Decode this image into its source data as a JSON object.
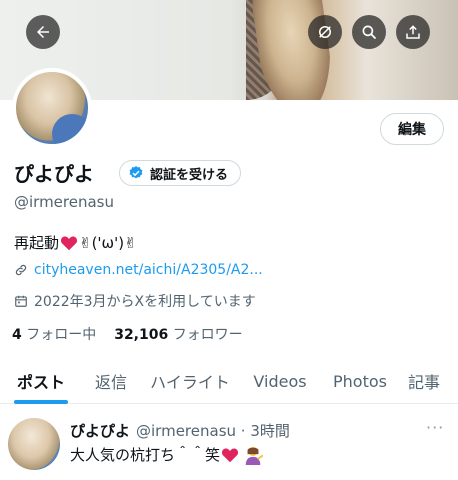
{
  "header": {
    "back_icon": "arrow-left-icon",
    "mute_icon": "slash-circle-icon",
    "search_icon": "search-icon",
    "share_icon": "share-icon"
  },
  "profile": {
    "edit_label": "編集",
    "name": "ぴよぴよ",
    "verify_label": "認証を受ける",
    "handle": "@irmerenasu",
    "bio_prefix": "再起動",
    "bio_suffix": "✌('ω')✌",
    "link": "cityheaven.net/aichi/A2305/A2...",
    "joined": "2022年3月からXを利用しています",
    "following_count": "4",
    "following_label": "フォロー中",
    "followers_count": "32,106",
    "followers_label": "フォロワー"
  },
  "tabs": [
    "ポスト",
    "返信",
    "ハイライト",
    "Videos",
    "Photos",
    "記事"
  ],
  "tweet": {
    "name": "ぴよぴよ",
    "meta": "@irmerenasu · 3時間",
    "text": "大人気の杭打ち＾＾笑",
    "more": "···"
  },
  "colors": {
    "accent": "#1d9bf0",
    "heart": "#e0245e",
    "verify_badge": "#1d9bf0"
  }
}
